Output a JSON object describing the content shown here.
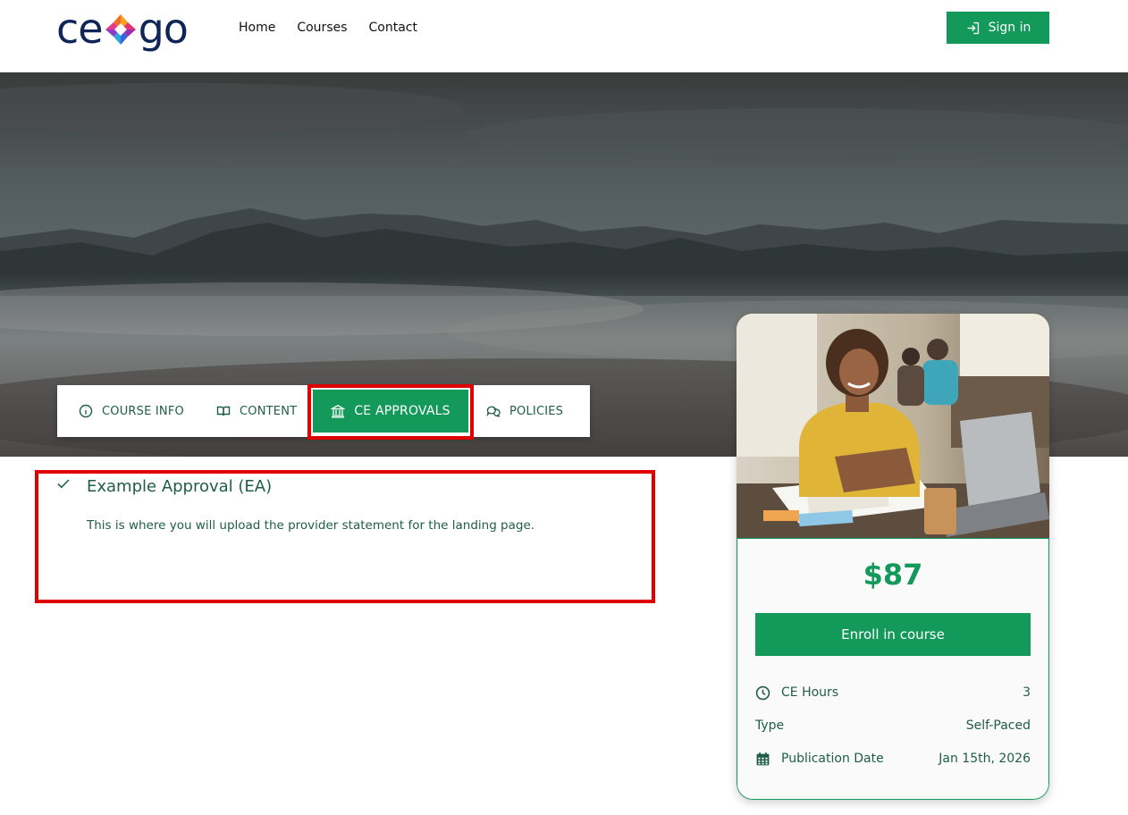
{
  "brand": {
    "logo_left": "ce",
    "logo_right": "go",
    "accent": "#139a5a",
    "highlight": "#e00000",
    "text_color": "#1f5e45"
  },
  "nav": {
    "items": [
      "Home",
      "Courses",
      "Contact"
    ]
  },
  "header": {
    "signin_label": "Sign in",
    "signin_icon": "sign-in-icon"
  },
  "tabs": [
    {
      "label": "COURSE INFO",
      "icon": "info-circle-icon",
      "active": false
    },
    {
      "label": "CONTENT",
      "icon": "open-book-icon",
      "active": false
    },
    {
      "label": "CE APPROVALS",
      "icon": "bank-building-icon",
      "active": true
    },
    {
      "label": "POLICIES",
      "icon": "chat-bubbles-icon",
      "active": false
    }
  ],
  "approval": {
    "title": "Example Approval (EA)",
    "description": "This is where you will upload the provider statement for the landing page.",
    "icon": "check-icon"
  },
  "card": {
    "price": "$87",
    "enroll_label": "Enroll in course",
    "details": [
      {
        "label": "CE Hours",
        "value": "3",
        "icon": "clock-icon"
      },
      {
        "label": "Type",
        "value": "Self-Paced",
        "icon": ""
      },
      {
        "label": "Publication Date",
        "value": "Jan 15th, 2026",
        "icon": "calendar-icon"
      }
    ]
  }
}
